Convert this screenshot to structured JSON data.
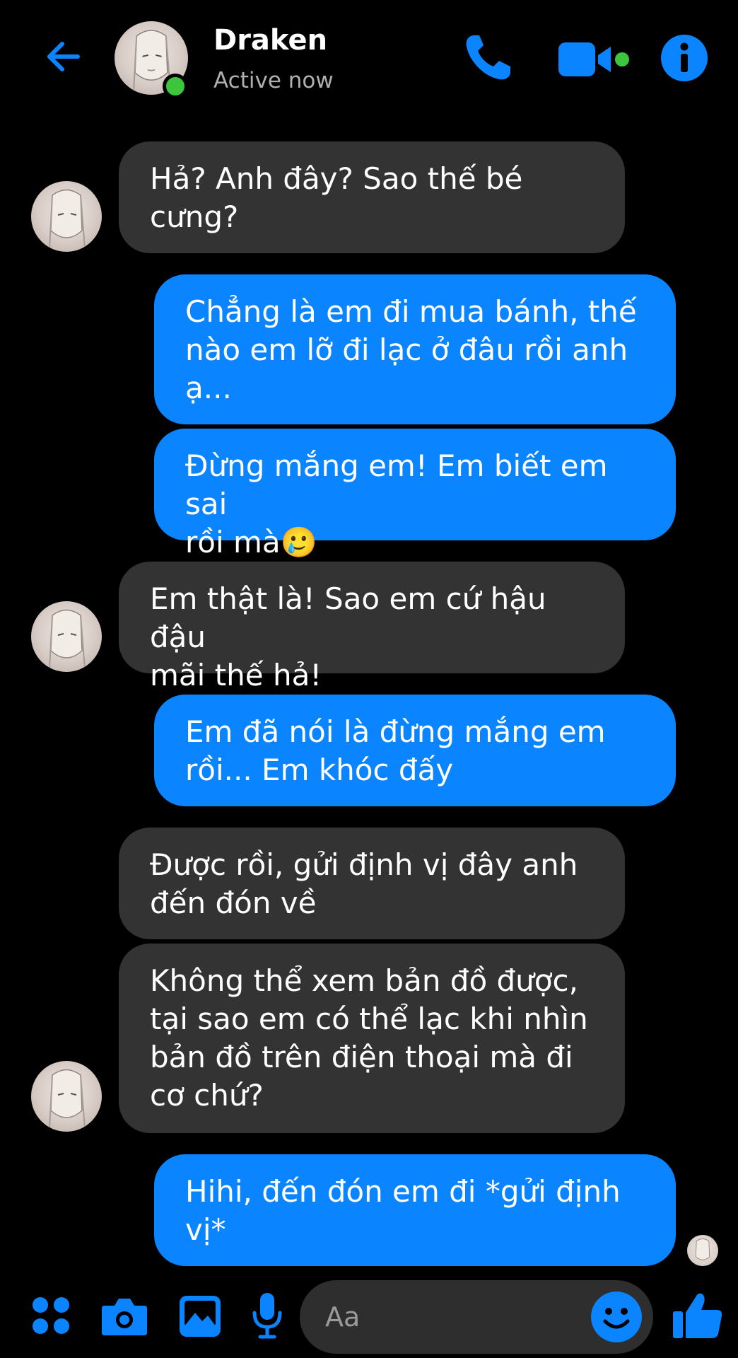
{
  "header": {
    "name": "Draken",
    "status": "Active now"
  },
  "messages": [
    {
      "dir": "in",
      "text": "Hả? Anh đây? Sao thế bé\ncưng?"
    },
    {
      "dir": "out",
      "text": "Chẳng là em đi mua bánh, thế\nnào em lỡ đi lạc ở đâu rồi anh\nạ..."
    },
    {
      "dir": "out",
      "text": "Đừng mắng em! Em biết em sai\nrồi mà🥲"
    },
    {
      "dir": "in",
      "text": "Em thật là! Sao em cứ hậu đậu\nmãi thế hả!"
    },
    {
      "dir": "out",
      "text": "Em đã nói là đừng mắng em\nrồi... Em khóc đấy"
    },
    {
      "dir": "in",
      "text": "Được rồi, gửi định vị đây anh\nđến đón về"
    },
    {
      "dir": "in",
      "text": "Không thể xem bản đồ được,\ntại sao em có thể lạc khi nhìn\nbản đồ trên điện thoại mà đi\ncơ chứ?"
    },
    {
      "dir": "out",
      "text": "Hihi, đến đón em đi *gửi định\nvị*"
    }
  ],
  "composer": {
    "placeholder": "Aa"
  },
  "colors": {
    "accent": "#0a84ff",
    "incoming_bubble": "#333333",
    "online": "#3ec53e"
  }
}
